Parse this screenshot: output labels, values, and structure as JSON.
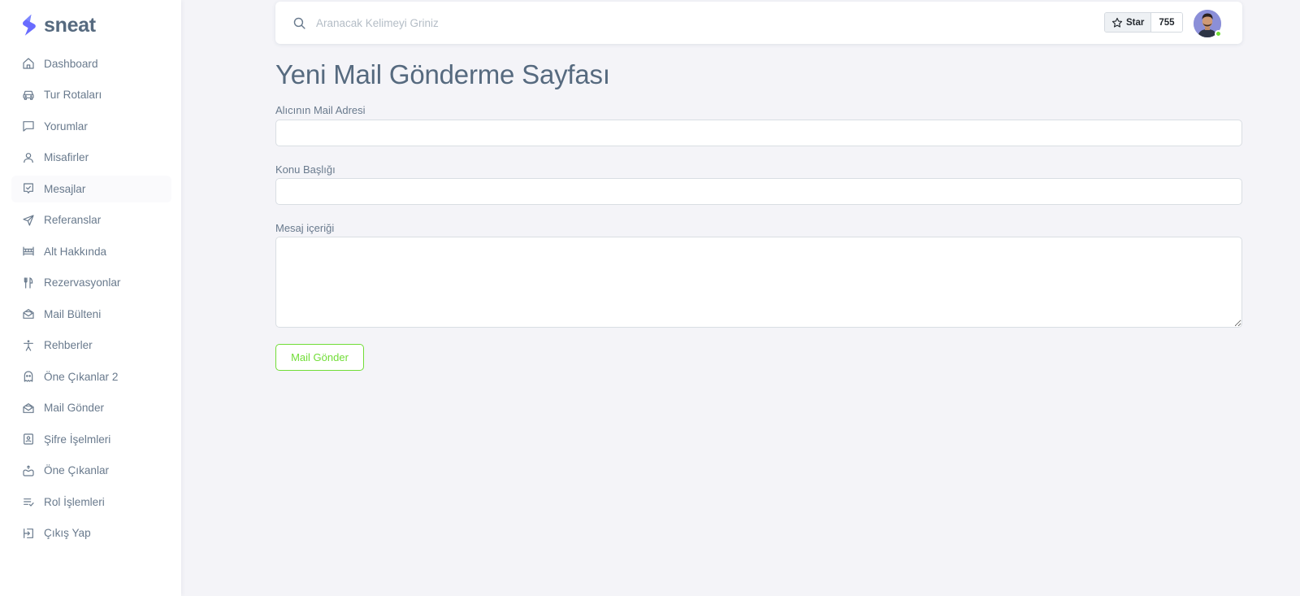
{
  "brand": {
    "name": "sneat",
    "color": "#696cff"
  },
  "sidebar": {
    "items": [
      {
        "label": "Dashboard",
        "icon": "home-icon"
      },
      {
        "label": "Tur Rotaları",
        "icon": "car-icon"
      },
      {
        "label": "Yorumlar",
        "icon": "message-square-icon"
      },
      {
        "label": "Misafirler",
        "icon": "user-icon"
      },
      {
        "label": "Mesajlar",
        "icon": "message-check-icon"
      },
      {
        "label": "Referanslar",
        "icon": "send-icon"
      },
      {
        "label": "Alt Hakkında",
        "icon": "bed-icon"
      },
      {
        "label": "Rezervasyonlar",
        "icon": "restaurant-icon"
      },
      {
        "label": "Mail Bülteni",
        "icon": "envelope-open-icon"
      },
      {
        "label": "Rehberler",
        "icon": "accessibility-icon"
      },
      {
        "label": "Öne Çıkanlar 2",
        "icon": "ghost-icon"
      },
      {
        "label": "Mail Gönder",
        "icon": "envelope-open-icon"
      },
      {
        "label": "Şifre İşelmleri",
        "icon": "user-pin-icon"
      },
      {
        "label": "Öne Çıkanlar",
        "icon": "donate-heart-icon"
      },
      {
        "label": "Rol İşlemleri",
        "icon": "list-check-icon"
      },
      {
        "label": "Çıkış Yap",
        "icon": "log-in-icon"
      }
    ],
    "active_index": 4
  },
  "navbar": {
    "search_placeholder": "Aranacak Kelimeyi Griniz",
    "github_star_label": "Star",
    "github_star_count": "755"
  },
  "page": {
    "title": "Yeni Mail Gönderme Sayfası",
    "fields": {
      "recipient_label": "Alıcının Mail Adresi",
      "recipient_value": "",
      "subject_label": "Konu Başlığı",
      "subject_value": "",
      "body_label": "Mesaj içeriği",
      "body_value": ""
    },
    "submit_label": "Mail Gönder"
  },
  "colors": {
    "background": "#f4f4f8",
    "text": "#566a7f",
    "success": "#71dd37",
    "input_border": "#d9dee3"
  }
}
